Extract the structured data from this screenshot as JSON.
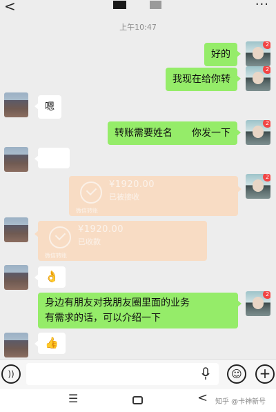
{
  "status": {
    "time": "上午10:47"
  },
  "icons": {
    "back": "chevron-left-icon",
    "more": "more-dots-icon",
    "voice": "voice-icon",
    "mic": "mic-icon",
    "emoji": "smile-icon",
    "plus": "plus-icon"
  },
  "avatar_badge": "2",
  "messages": {
    "m1": "好的",
    "m2": "我现在给你转",
    "m3": "嗯",
    "m4": "转账需要姓名　　你发一下",
    "t1_amount": "¥1920.00",
    "t1_status": "已被接收",
    "t1_footer": "微信转账",
    "t2_amount": "¥1920.00",
    "t2_status": "已收款",
    "t2_footer": "微信转账",
    "emoji_ok": "👌",
    "m_long_1": "身边有朋友对我朋友圈里面的业务",
    "m_long_2": "有需求的话，可以介绍一下",
    "emoji_thumb": "👍"
  },
  "nav": {
    "menu_glyph": "☰",
    "back_glyph": "<"
  },
  "watermark": "知乎 @卡神新号",
  "colors": {
    "bubble_green": "#95ec69",
    "bubble_white": "#ffffff",
    "transfer_bg": "#f8dcc4",
    "chat_bg": "#ededed"
  }
}
